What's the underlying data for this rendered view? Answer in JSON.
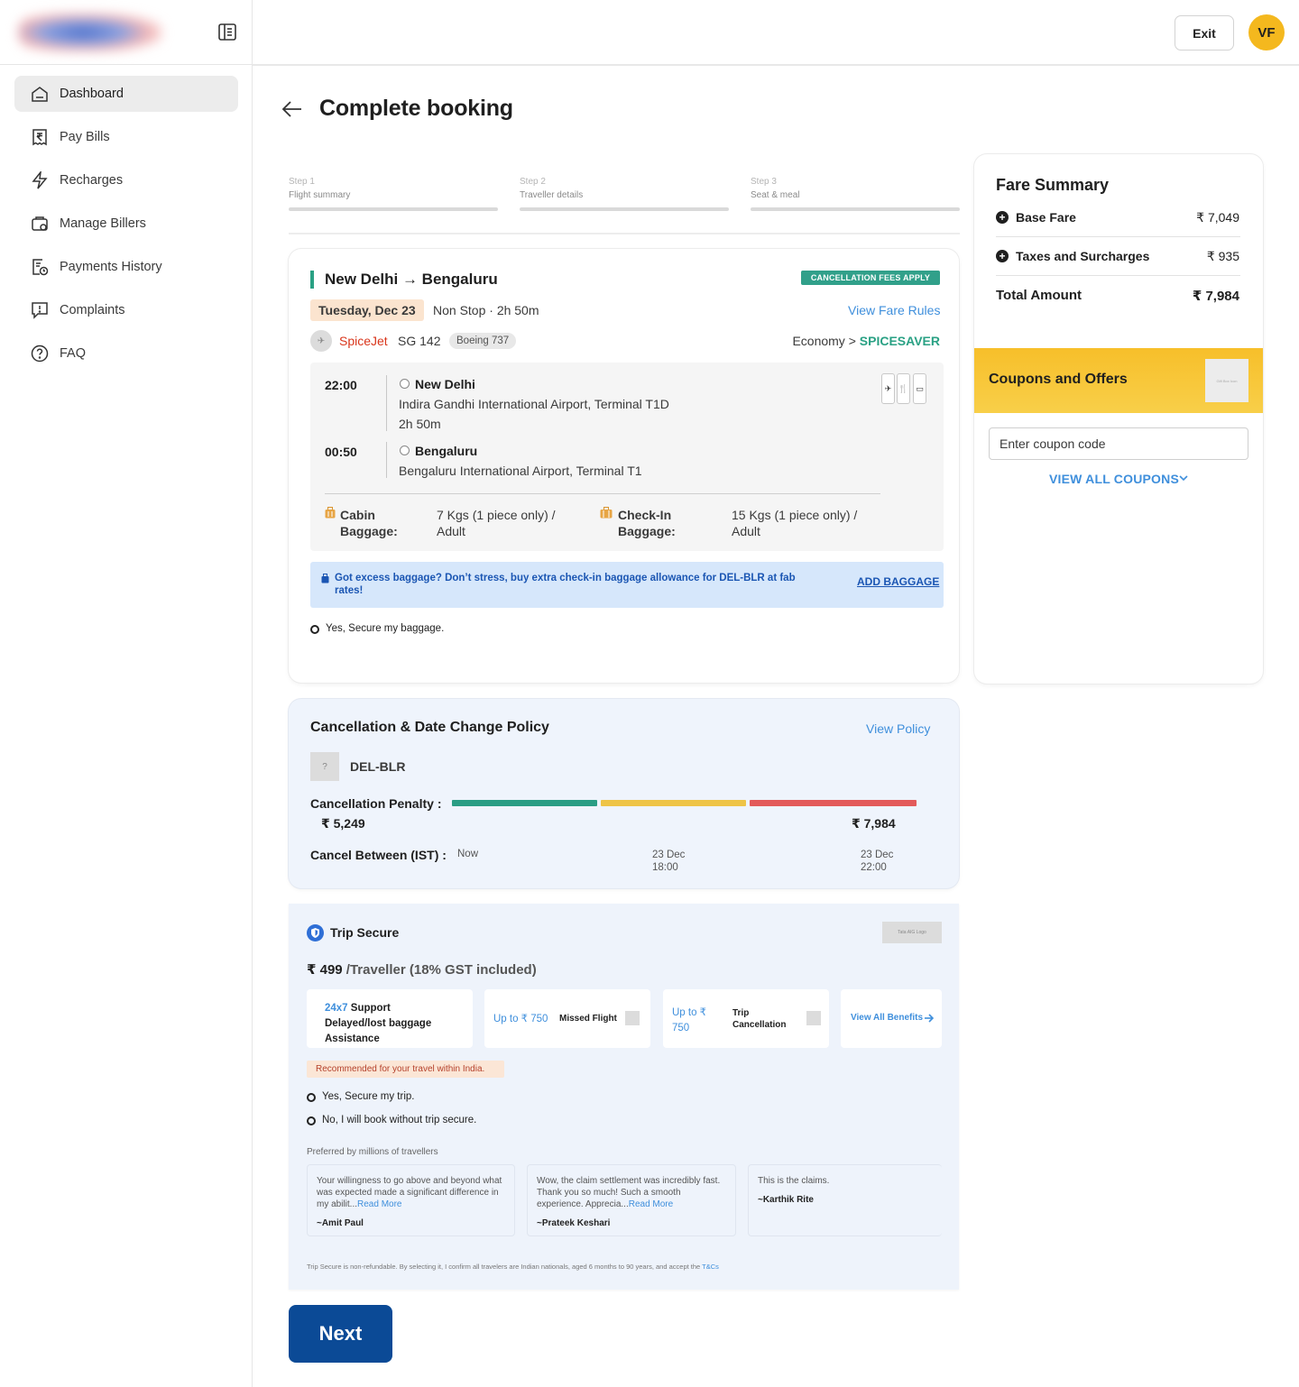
{
  "sidebar": {
    "items": [
      {
        "label": "Dashboard",
        "icon": "home-icon",
        "active": true
      },
      {
        "label": "Pay Bills",
        "icon": "bill-icon"
      },
      {
        "label": "Recharges",
        "icon": "lightning-icon"
      },
      {
        "label": "Manage Billers",
        "icon": "billers-gear-icon"
      },
      {
        "label": "Payments History",
        "icon": "history-icon"
      },
      {
        "label": "Complaints",
        "icon": "complaint-icon"
      },
      {
        "label": "FAQ",
        "icon": "question-icon"
      }
    ]
  },
  "header": {
    "exit_label": "Exit",
    "avatar_initials": "VF"
  },
  "page": {
    "title": "Complete booking"
  },
  "steps": [
    {
      "num": "Step 1",
      "label": "Flight summary"
    },
    {
      "num": "Step 2",
      "label": "Traveller details"
    },
    {
      "num": "Step 3",
      "label": "Seat & meal"
    }
  ],
  "flight": {
    "route": "New Delhi → Bengaluru",
    "cancel_tag": "CANCELLATION FEES APPLY",
    "date": "Tuesday, Dec 23",
    "stops_duration": "Non Stop · 2h 50m",
    "fare_rules": "View Fare Rules",
    "airline": "SpiceJet",
    "flight_no": "SG 142",
    "aircraft": "Boeing 737",
    "class_prefix": "Economy > ",
    "fare_type": "SPICESAVER",
    "dep_time": "22:00",
    "dep_city": "New Delhi",
    "dep_airport": "Indira Gandhi International Airport, Terminal T1D",
    "duration": "2h 50m",
    "arr_time": "00:50",
    "arr_city": "Bengaluru",
    "arr_airport": "Bengaluru International Airport, Terminal T1",
    "cabin_label_1": "Cabin",
    "cabin_label_2": "Baggage:",
    "cabin_val_1": "7 Kgs (1 piece only) /",
    "cabin_val_2": "Adult",
    "checkin_label_1": "Check-In",
    "checkin_label_2": "Baggage:",
    "checkin_val_1": "15 Kgs (1 piece only) /",
    "checkin_val_2": "Adult",
    "excess_text": "Got excess baggage? Don’t stress, buy extra check-in baggage allowance for DEL-BLR at fab rates!",
    "add_baggage": "ADD BAGGAGE",
    "secure_baggage": "Yes, Secure my baggage."
  },
  "policy": {
    "title": "Cancellation & Date Change Policy",
    "view_policy": "View Policy",
    "sector": "DEL-BLR",
    "penalty_label": "Cancellation Penalty :",
    "penalty_low": "₹ 5,249",
    "penalty_high": "₹ 7,984",
    "between_label": "Cancel Between (IST) :",
    "t1": "Now",
    "t2_date": "23 Dec",
    "t2_time": "18:00",
    "t3_date": "23 Dec",
    "t3_time": "22:00",
    "colors": [
      "#2a9d84",
      "#eec447",
      "#e35a5a"
    ]
  },
  "trip_secure": {
    "title": "Trip Secure",
    "partner_logo": "Tata AIG Logo",
    "price": "₹ 499",
    "price_suffix": " /Traveller (18% GST included)",
    "b1_hl": "24x7",
    "b1_a": " Support",
    "b1_b": "Delayed/lost baggage",
    "b1_c": "Assistance",
    "b2_amt": "Up to ₹ 750",
    "b2_label": "Missed Flight",
    "b3_amt_1": "Up to ₹",
    "b3_amt_2": "750",
    "b3_label_1": "Trip",
    "b3_label_2": "Cancellation",
    "b4_link": "View All Benefits",
    "recommended": "Recommended for your travel within India.",
    "opt_yes": "Yes, Secure my trip.",
    "opt_no": "No, I will book without trip secure.",
    "preferred": "Preferred by millions of travellers",
    "reviews": [
      {
        "text": "Your willingness to go above and beyond what was expected made a significant difference in my abilit...",
        "more": "Read More",
        "author": "~Amit Paul"
      },
      {
        "text": "Wow, the claim settlement was incredibly fast. Thank you so much! Such a smooth experience. Apprecia...",
        "more": "Read More",
        "author": "~Prateek Keshari"
      },
      {
        "text": "This is the claims.",
        "more": "",
        "author": "~Karthik Rite"
      }
    ],
    "disclaimer": "Trip Secure is non-refundable. By selecting it, I confirm all travelers are Indian nationals, aged 6 months to 90 years, and accept the ",
    "tnc": "T&Cs"
  },
  "next_label": "Next",
  "fare": {
    "title": "Fare Summary",
    "base_label": "Base Fare",
    "base_val": "₹ 7,049",
    "tax_label": "Taxes and Surcharges",
    "tax_val": "₹ 935",
    "total_label": "Total Amount",
    "total_val": "₹ 7,984",
    "coupons_title": "Coupons and Offers",
    "coupon_banner": "Gift Box Icon",
    "coupon_placeholder": "Enter coupon code",
    "view_all": "VIEW ALL COUPONS"
  }
}
